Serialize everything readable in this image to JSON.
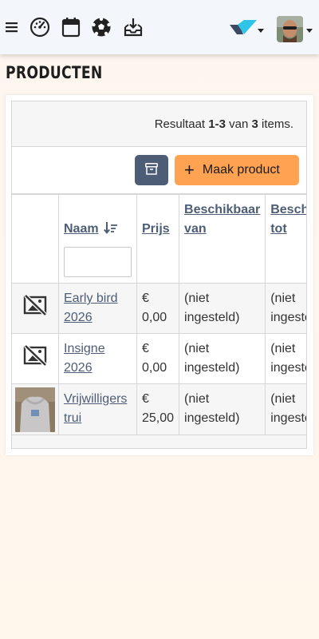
{
  "nav": {
    "menu_icon": "hamburger-icon",
    "items": [
      {
        "icon": "dashboard-icon"
      },
      {
        "icon": "calendar-icon"
      },
      {
        "icon": "soccer-ball-icon"
      },
      {
        "icon": "inbox-download-icon"
      }
    ],
    "brand_icon": "brand-logo-icon",
    "avatar_icon": "user-avatar"
  },
  "page": {
    "title": "Producten"
  },
  "summary": {
    "prefix": "Resultaat ",
    "range": "1-3",
    "middle": " van ",
    "total": "3",
    "suffix": " items."
  },
  "toolbar": {
    "archive_icon": "archive-icon",
    "create_label": "Maak product",
    "create_icon": "+"
  },
  "table": {
    "columns": {
      "name": "Naam",
      "price": "Prijs",
      "available_from": "Beschikbaar van",
      "available_to": "Beschikbaar tot"
    },
    "sort_icon": "sort-descending-icon",
    "name_filter_value": "",
    "rows": [
      {
        "image": "no-image-icon",
        "name": "Early bird 2026",
        "price": "€ 0,00",
        "from": "(niet ingesteld)",
        "to": "(niet ingesteld)"
      },
      {
        "image": "no-image-icon",
        "name": "Insigne 2026",
        "price": "€ 0,00",
        "from": "(niet ingesteld)",
        "to": "(niet ingesteld)"
      },
      {
        "image": "product-photo",
        "name": "Vrijwilligers trui",
        "price": "€ 25,00",
        "from": "(niet ingesteld)",
        "to": "(niet ingesteld)"
      }
    ]
  },
  "colors": {
    "primary": "#4d5d75",
    "accent": "#ffa352",
    "brand": "#30c5e8"
  }
}
